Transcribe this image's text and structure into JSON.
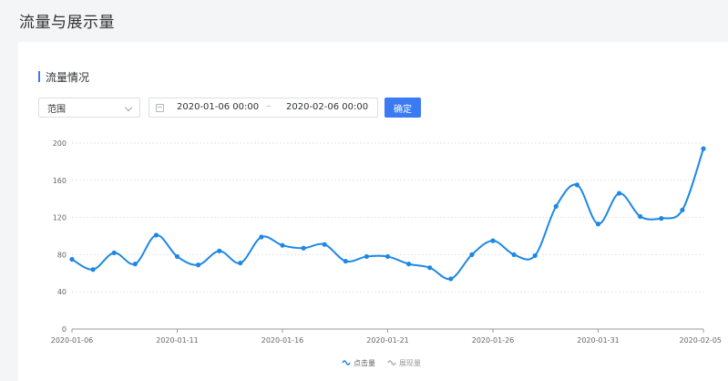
{
  "page": {
    "title": "流量与展示量"
  },
  "section": {
    "title": "流量情况"
  },
  "filters": {
    "range_select_value": "范围",
    "date_start": "2020-01-06 00:00",
    "date_separator": "–",
    "date_end": "2020-02-06 00:00",
    "confirm_label": "确定"
  },
  "colors": {
    "accent": "#3a7af2",
    "series_clicks": "#1e88e5",
    "series_views": "#b0b0b0"
  },
  "chart_data": {
    "type": "line",
    "x": [
      "2020-01-06",
      "2020-01-07",
      "2020-01-08",
      "2020-01-09",
      "2020-01-10",
      "2020-01-11",
      "2020-01-12",
      "2020-01-13",
      "2020-01-14",
      "2020-01-15",
      "2020-01-16",
      "2020-01-17",
      "2020-01-18",
      "2020-01-19",
      "2020-01-20",
      "2020-01-21",
      "2020-01-22",
      "2020-01-23",
      "2020-01-24",
      "2020-01-25",
      "2020-01-26",
      "2020-01-27",
      "2020-01-28",
      "2020-01-29",
      "2020-01-30",
      "2020-01-31",
      "2020-02-01",
      "2020-02-02",
      "2020-02-03",
      "2020-02-04",
      "2020-02-05"
    ],
    "x_tick_labels": [
      "2020-01-06",
      "2020-01-11",
      "2020-01-16",
      "2020-01-21",
      "2020-01-26",
      "2020-01-31",
      "2020-02-05"
    ],
    "series": [
      {
        "name": "点击量",
        "values": [
          75,
          64,
          82,
          70,
          101,
          78,
          69,
          84,
          71,
          99,
          90,
          87,
          91,
          73,
          78,
          78,
          70,
          66,
          54,
          80,
          95,
          80,
          79,
          132,
          155,
          113,
          146,
          121,
          119,
          128,
          194
        ],
        "visible": true
      },
      {
        "name": "展现量",
        "values": [],
        "visible": false
      }
    ],
    "ylim": [
      0,
      200
    ],
    "y_ticks": [
      0,
      40,
      80,
      120,
      160,
      200
    ],
    "grid": true,
    "legend": "bottom-center"
  }
}
